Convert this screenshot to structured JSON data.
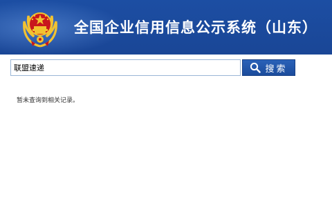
{
  "header": {
    "title": "全国企业信用信息公示系统（山东）",
    "background_color": "#1c4ea3",
    "emblem_icon": "national-emblem-icon"
  },
  "search": {
    "query": "联盟速递",
    "button_label": "搜索",
    "button_icon": "search-icon",
    "button_color": "#1b4c9c"
  },
  "results": {
    "message": "暂未查询到相关记录。"
  }
}
